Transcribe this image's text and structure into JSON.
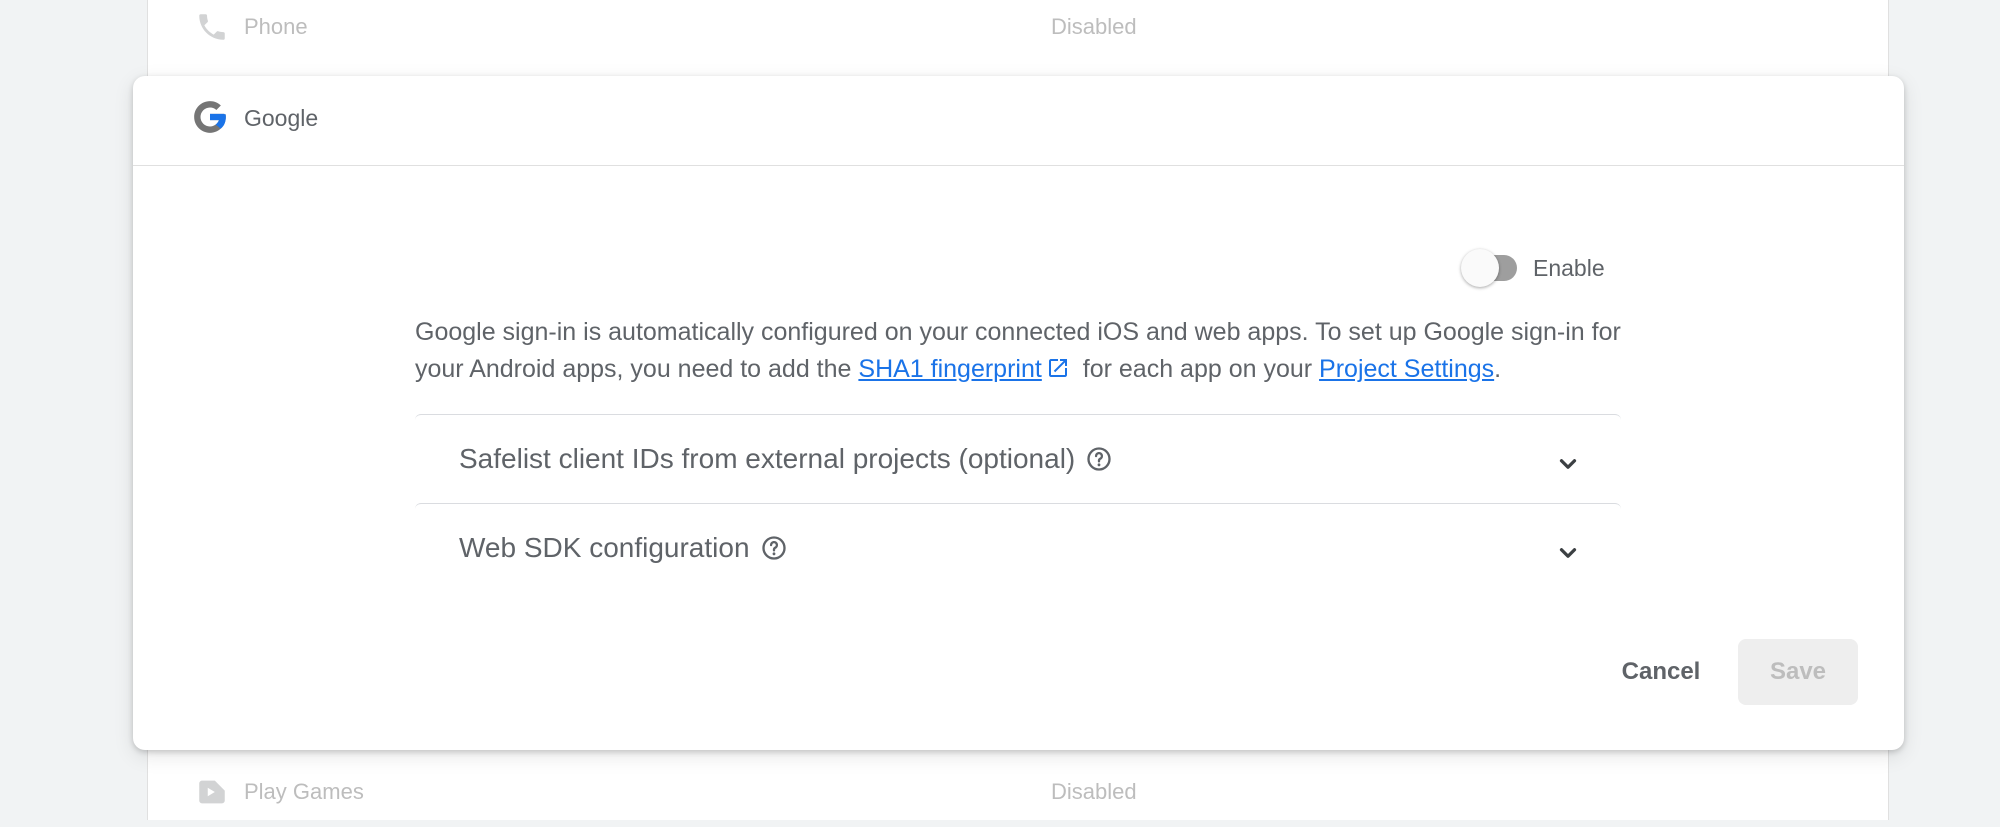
{
  "providers": {
    "above": {
      "name": "Phone",
      "status": "Disabled",
      "icon": "phone-icon"
    },
    "below": {
      "name": "Play Games",
      "status": "Disabled",
      "icon": "play-games-icon"
    }
  },
  "dialog": {
    "title": "Google",
    "icon": "google-logo",
    "enable_label": "Enable",
    "enabled": false,
    "description": {
      "part1": "Google sign-in is automatically configured on your connected iOS and web apps. To set up Google sign-in for your Android apps, you need to add the ",
      "link1": "SHA1 fingerprint",
      "part2": " for each app on your ",
      "link2": "Project Settings",
      "part3": "."
    },
    "panels": [
      {
        "title": "Safelist client IDs from external projects (optional)"
      },
      {
        "title": "Web SDK configuration"
      }
    ],
    "cancel_label": "Cancel",
    "save_label": "Save"
  },
  "colors": {
    "link": "#1a73e8",
    "text": "#5f6368",
    "disabled_text": "#bdbdbd",
    "background": "#f1f3f4"
  }
}
